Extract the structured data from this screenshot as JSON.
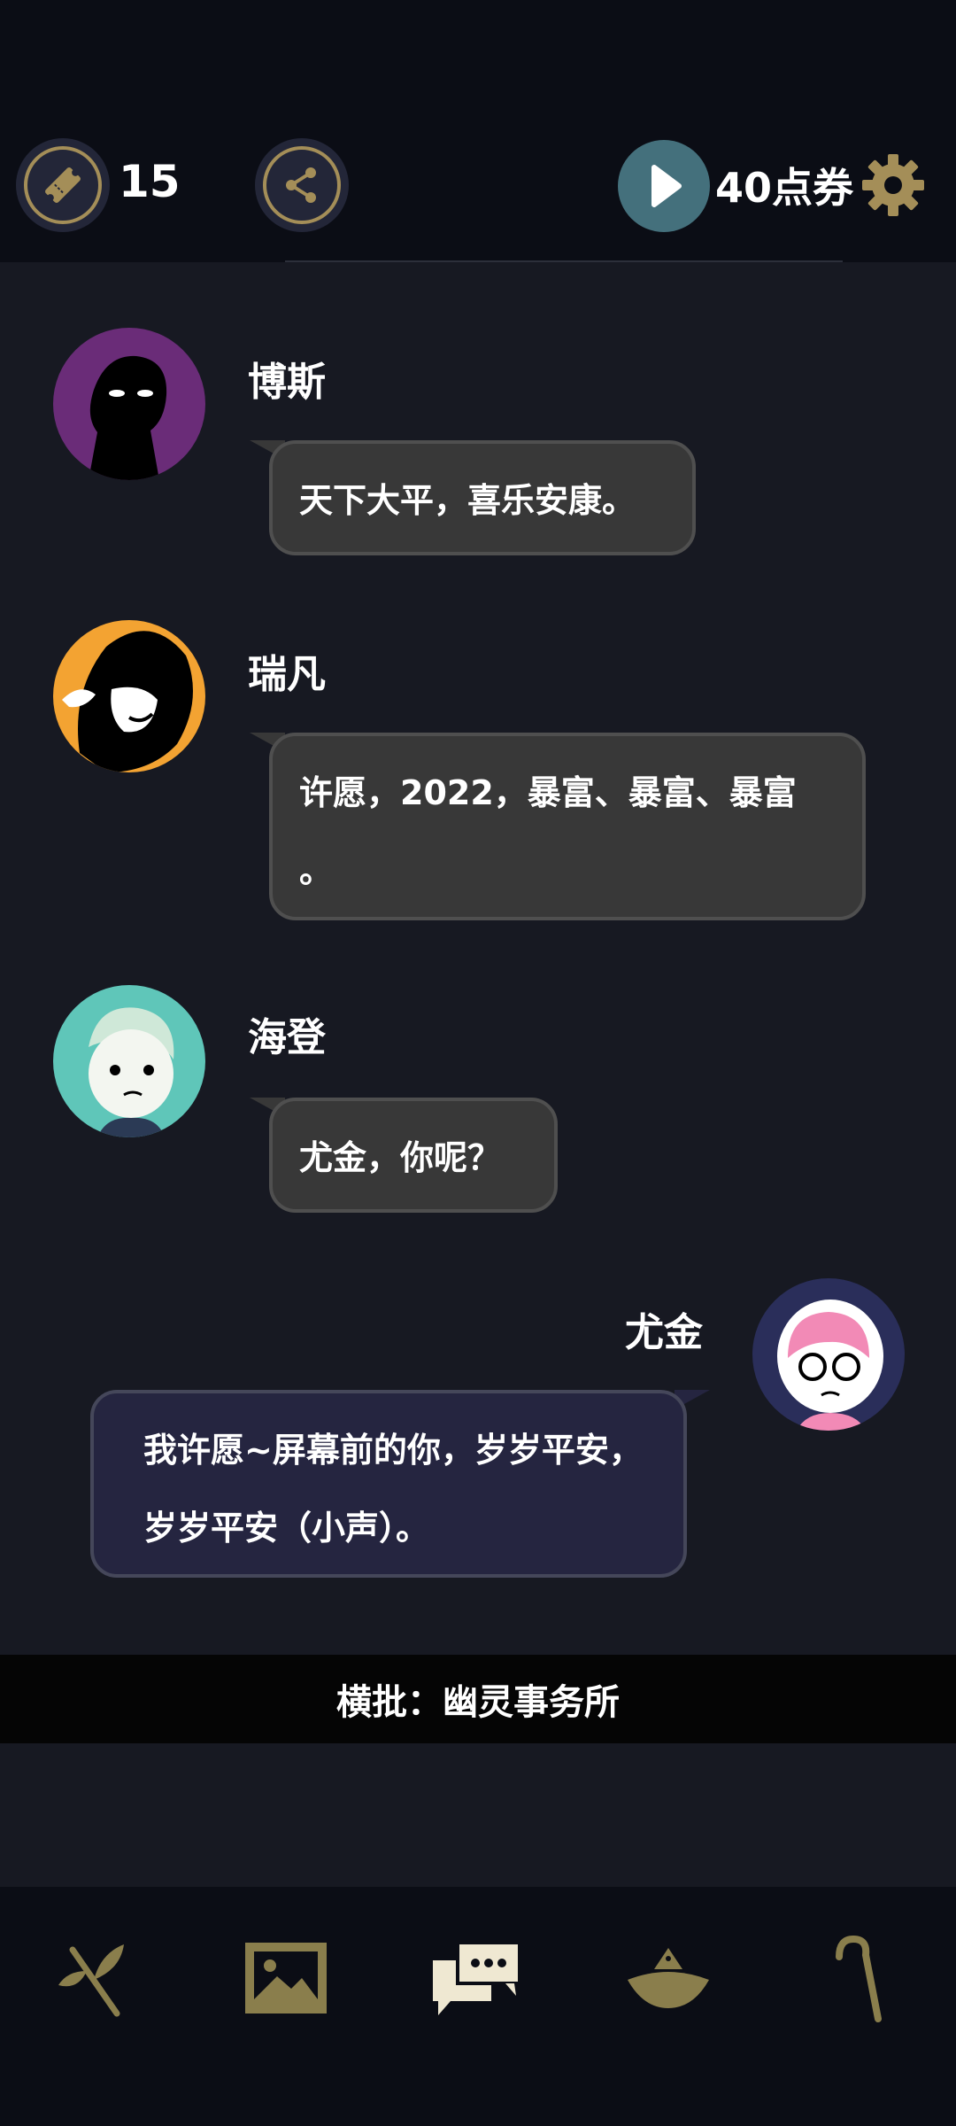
{
  "app_bar": {
    "ticket_count": "15",
    "coupon_label": "40点券"
  },
  "messages": [
    {
      "speaker": "博斯",
      "text": "天下大平，喜乐安康。"
    },
    {
      "speaker": "瑞凡",
      "text_line1": "许愿，2022，暴富、暴富、暴富",
      "text_line2": "。"
    },
    {
      "speaker": "海登",
      "text": "尤金，你呢？"
    },
    {
      "speaker": "尤金",
      "text_line1": "我许愿~屏幕前的你，岁岁平安，",
      "text_line2": "岁岁平安（小声）。"
    }
  ],
  "banner": {
    "text": "横批：幽灵事务所"
  },
  "nav": {
    "items": [
      "branch-icon",
      "gallery-icon",
      "chat-icon",
      "hat-icon",
      "cane-icon"
    ],
    "active_index": 2
  },
  "colors": {
    "accent_gold": "#a48e58",
    "bubble_gray": "#383838",
    "bubble_mine": "#252540",
    "play_teal": "#44707c"
  }
}
